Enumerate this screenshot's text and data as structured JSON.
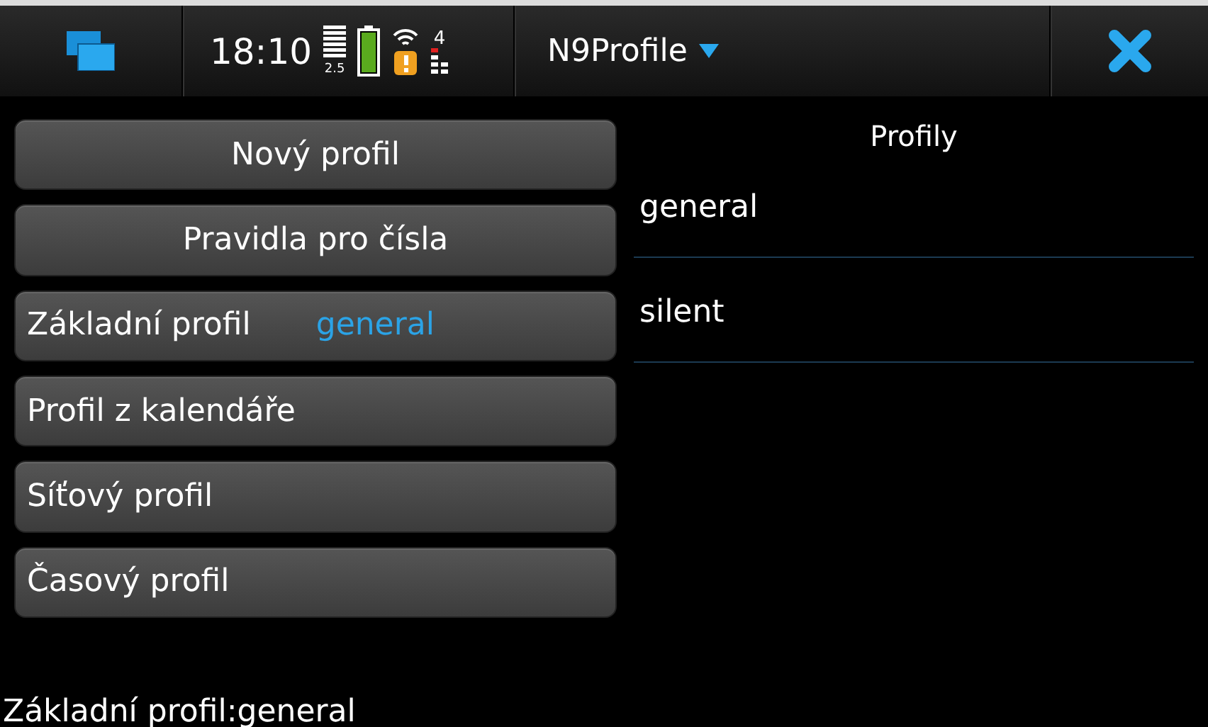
{
  "status_bar": {
    "time": "18:10",
    "data_rate": "2.5",
    "signal_count": "4",
    "app_title": "N9Profile"
  },
  "buttons": [
    {
      "kind": "centered",
      "label": "Nový profil"
    },
    {
      "kind": "centered",
      "label": "Pravidla pro čísla"
    },
    {
      "kind": "value",
      "label": "Základní profil",
      "value": "general"
    },
    {
      "kind": "left",
      "label": "Profil z kalendáře"
    },
    {
      "kind": "left",
      "label": "Síťový profil"
    },
    {
      "kind": "left",
      "label": "Časový profil"
    }
  ],
  "profiles": {
    "title": "Profily",
    "items": [
      "general",
      "silent"
    ]
  },
  "footer": "Základní profil:general"
}
